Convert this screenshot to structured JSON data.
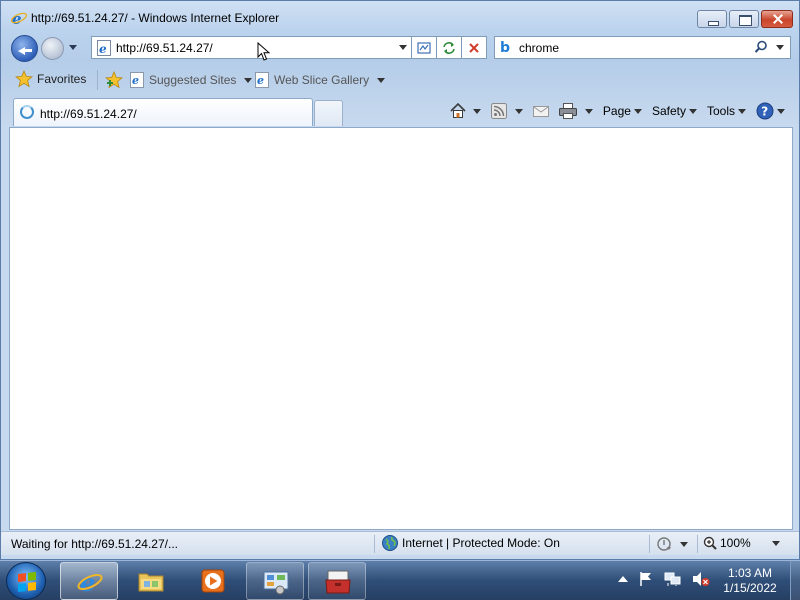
{
  "window": {
    "title": "http://69.51.24.27/ - Windows Internet Explorer"
  },
  "nav": {
    "address": "http://69.51.24.27/",
    "search_value": "chrome"
  },
  "favorites_bar": {
    "favorites_label": "Favorites",
    "links": [
      {
        "label": "Suggested Sites"
      },
      {
        "label": "Web Slice Gallery"
      }
    ]
  },
  "tabs": [
    {
      "label": "http://69.51.24.27/"
    }
  ],
  "command_bar": {
    "page_label": "Page",
    "safety_label": "Safety",
    "tools_label": "Tools"
  },
  "status_bar": {
    "status_text": "Waiting for http://69.51.24.27/...",
    "zone_text": "Internet | Protected Mode: On",
    "zoom_text": "100%"
  },
  "taskbar": {
    "apps": [
      {
        "name": "internet-explorer"
      },
      {
        "name": "windows-explorer"
      },
      {
        "name": "media-player"
      },
      {
        "name": "control-panel"
      },
      {
        "name": "toolbox-app"
      }
    ],
    "clock_time": "1:03 AM",
    "clock_date": "1/15/2022"
  },
  "colors": {
    "accent": "#1f7dd6",
    "taskbar": "#2f4e77",
    "close_button": "#c9452c"
  }
}
